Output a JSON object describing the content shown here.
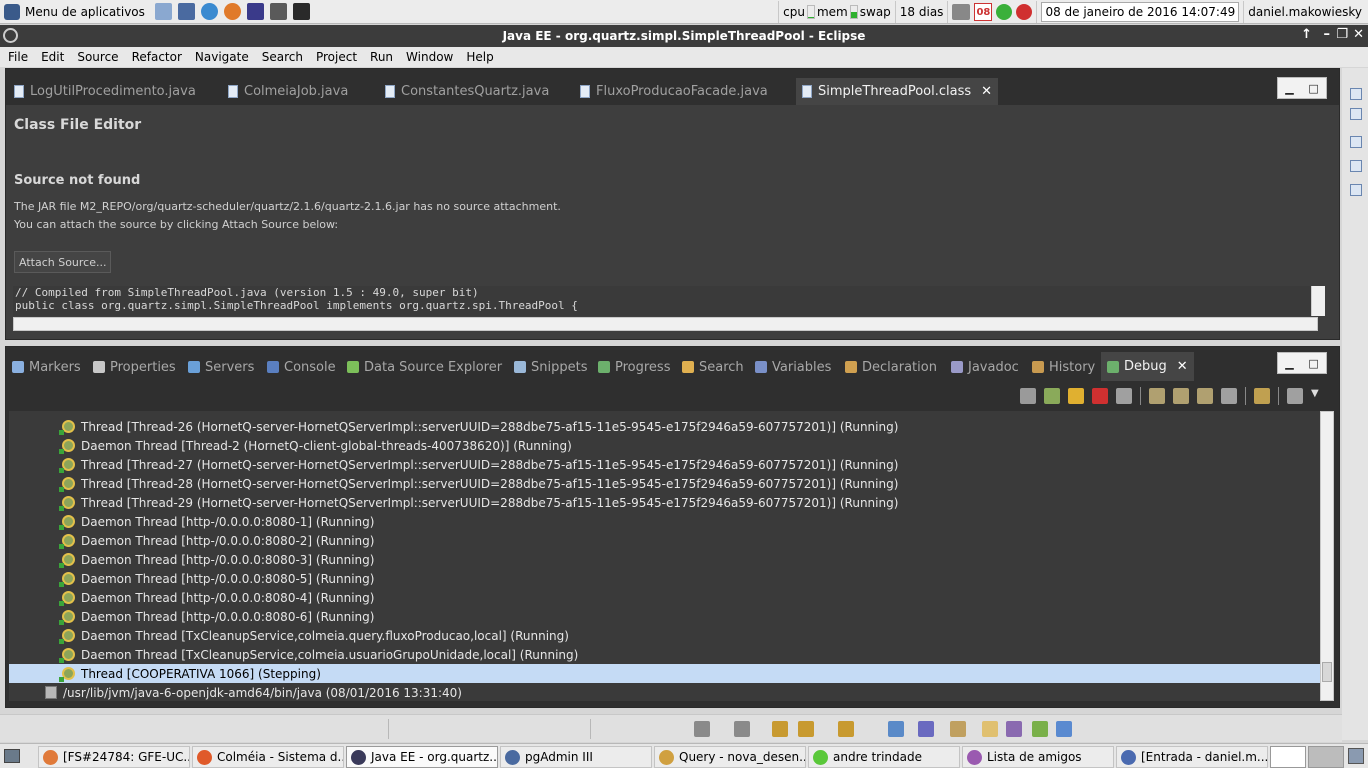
{
  "system_panel": {
    "apps_menu_label": "Menu de aplicativos",
    "cpu_label": "cpu",
    "mem_label": "mem",
    "mem_usage_fraction": 0.5,
    "swap_label": "swap",
    "uptime": "18 dias",
    "calendar_day": "08",
    "datetime": "08 de janeiro de 2016 14:07:49",
    "username": "daniel.makowiesky"
  },
  "window": {
    "title": "Java EE - org.quartz.simpl.SimpleThreadPool - Eclipse"
  },
  "menu": [
    "File",
    "Edit",
    "Source",
    "Refactor",
    "Navigate",
    "Search",
    "Project",
    "Run",
    "Window",
    "Help"
  ],
  "editor": {
    "tabs": [
      {
        "label": "LogUtilProcedimento.java"
      },
      {
        "label": "ColmeiaJob.java"
      },
      {
        "label": "ConstantesQuartz.java"
      },
      {
        "label": "FluxoProducaoFacade.java"
      },
      {
        "label": "SimpleThreadPool.class"
      }
    ],
    "active_tab_close": "✕",
    "heading": "Class File Editor",
    "source_not_found": "Source not found",
    "message_line1": "The JAR file M2_REPO/org/quartz-scheduler/quartz/2.1.6/quartz-2.1.6.jar has no source attachment.",
    "message_line2": "You can attach the source by clicking Attach Source below:",
    "attach_button": "Attach Source...",
    "code_line1": "// Compiled from SimpleThreadPool.java (version 1.5 : 49.0, super bit)",
    "code_line2": "public class org.quartz.simpl.SimpleThreadPool implements org.quartz.spi.ThreadPool {"
  },
  "views": {
    "tabs": [
      {
        "label": "Markers",
        "color": "#8ab0e0"
      },
      {
        "label": "Properties",
        "color": "#c8c8c8"
      },
      {
        "label": "Servers",
        "color": "#6aa0d8"
      },
      {
        "label": "Console",
        "color": "#5a7fc0"
      },
      {
        "label": "Data Source Explorer",
        "color": "#7cbf5a"
      },
      {
        "label": "Snippets",
        "color": "#9ab8d8"
      },
      {
        "label": "Progress",
        "color": "#6cb06c"
      },
      {
        "label": "Search",
        "color": "#e0b050"
      },
      {
        "label": "Variables",
        "color": "#7a90c8"
      },
      {
        "label": "Declaration",
        "color": "#d0a050"
      },
      {
        "label": "Javadoc",
        "color": "#9a9ac8"
      },
      {
        "label": "History",
        "color": "#c89a50"
      },
      {
        "label": "Debug",
        "color": "#6cb06c"
      }
    ],
    "active_tab_close": "✕"
  },
  "debug_tree": {
    "rows": [
      {
        "label": "Thread [Thread-26 (HornetQ-server-HornetQServerImpl::serverUUID=288dbe75-af15-11e5-9545-e175f2946a59-607757201)] (Running)"
      },
      {
        "label": "Daemon Thread [Thread-2 (HornetQ-client-global-threads-400738620)] (Running)"
      },
      {
        "label": "Thread [Thread-27 (HornetQ-server-HornetQServerImpl::serverUUID=288dbe75-af15-11e5-9545-e175f2946a59-607757201)] (Running)"
      },
      {
        "label": "Thread [Thread-28 (HornetQ-server-HornetQServerImpl::serverUUID=288dbe75-af15-11e5-9545-e175f2946a59-607757201)] (Running)"
      },
      {
        "label": "Thread [Thread-29 (HornetQ-server-HornetQServerImpl::serverUUID=288dbe75-af15-11e5-9545-e175f2946a59-607757201)] (Running)"
      },
      {
        "label": "Daemon Thread [http-/0.0.0.0:8080-1] (Running)"
      },
      {
        "label": "Daemon Thread [http-/0.0.0.0:8080-2] (Running)"
      },
      {
        "label": "Daemon Thread [http-/0.0.0.0:8080-3] (Running)"
      },
      {
        "label": "Daemon Thread [http-/0.0.0.0:8080-5] (Running)"
      },
      {
        "label": "Daemon Thread [http-/0.0.0.0:8080-4] (Running)"
      },
      {
        "label": "Daemon Thread [http-/0.0.0.0:8080-6] (Running)"
      },
      {
        "label": "Daemon Thread [TxCleanupService,colmeia.query.fluxoProducao,local] (Running)"
      },
      {
        "label": "Daemon Thread [TxCleanupService,colmeia.usuarioGrupoUnidade,local] (Running)"
      },
      {
        "label": "Thread [COOPERATIVA 1066] (Stepping)",
        "selected": true
      }
    ],
    "process_label": "/usr/lib/jvm/java-6-openjdk-amd64/bin/java (08/01/2016 13:31:40)"
  },
  "taskbar": [
    {
      "label": "[FS#24784: GFE-UC...",
      "color": "#e07a3a"
    },
    {
      "label": "Colméia - Sistema d...",
      "color": "#e05a2a"
    },
    {
      "label": "Java EE - org.quartz...",
      "color": "#3a3a5a",
      "active": true
    },
    {
      "label": "pgAdmin III",
      "color": "#4a6aa0"
    },
    {
      "label": "Query - nova_desen...",
      "color": "#d0a040"
    },
    {
      "label": "andre trindade",
      "color": "#5ac83a"
    },
    {
      "label": "Lista de amigos",
      "color": "#9a5ab0"
    },
    {
      "label": "[Entrada - daniel.m...",
      "color": "#4a6ab0"
    }
  ]
}
